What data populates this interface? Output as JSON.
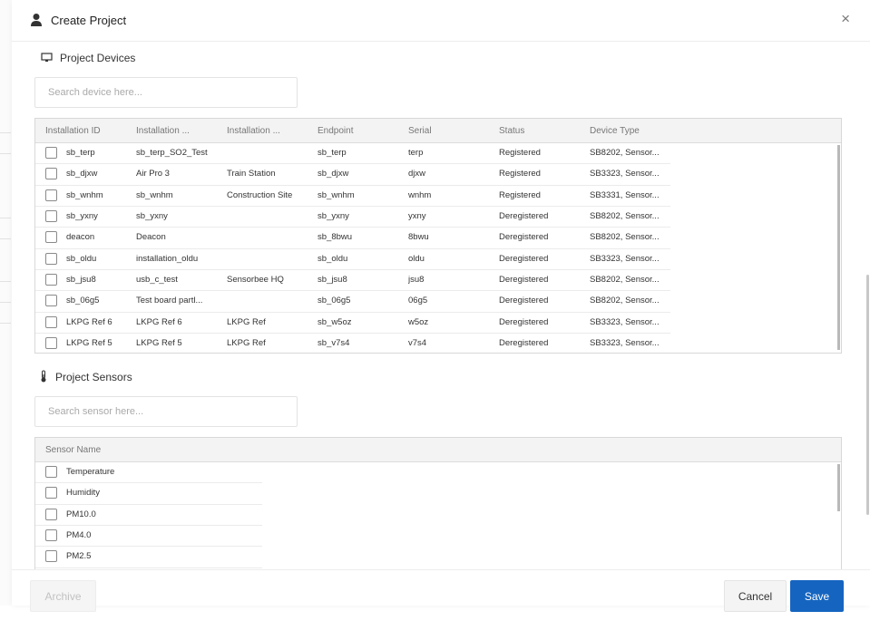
{
  "modal": {
    "title": "Create Project",
    "close_label": "×"
  },
  "devices": {
    "section_title": "Project Devices",
    "search_placeholder": "Search device here...",
    "columns": [
      "Installation ID",
      "Installation ...",
      "Installation ...",
      "Endpoint",
      "Serial",
      "Status",
      "Device Type"
    ],
    "rows": [
      [
        "sb_terp",
        "sb_terp_SO2_Test",
        "",
        "sb_terp",
        "terp",
        "Registered",
        "SB8202, Sensor..."
      ],
      [
        "sb_djxw",
        "Air Pro 3",
        "Train Station",
        "sb_djxw",
        "djxw",
        "Registered",
        "SB3323, Sensor..."
      ],
      [
        "sb_wnhm",
        "sb_wnhm",
        "Construction Site",
        "sb_wnhm",
        "wnhm",
        "Registered",
        "SB3331, Sensor..."
      ],
      [
        "sb_yxny",
        "sb_yxny",
        "",
        "sb_yxny",
        "yxny",
        "Deregistered",
        "SB8202, Sensor..."
      ],
      [
        "deacon",
        "Deacon",
        "",
        "sb_8bwu",
        "8bwu",
        "Deregistered",
        "SB8202, Sensor..."
      ],
      [
        "sb_oldu",
        "installation_oldu",
        "",
        "sb_oldu",
        "oldu",
        "Deregistered",
        "SB3323, Sensor..."
      ],
      [
        "sb_jsu8",
        "usb_c_test",
        "Sensorbee HQ",
        "sb_jsu8",
        "jsu8",
        "Deregistered",
        "SB8202, Sensor..."
      ],
      [
        "sb_06g5",
        "Test board partl...",
        "",
        "sb_06g5",
        "06g5",
        "Deregistered",
        "SB8202, Sensor..."
      ],
      [
        "LKPG Ref 6",
        "LKPG Ref 6",
        "LKPG Ref",
        "sb_w5oz",
        "w5oz",
        "Deregistered",
        "SB3323, Sensor..."
      ],
      [
        "LKPG Ref 5",
        "LKPG Ref 5",
        "LKPG Ref",
        "sb_v7s4",
        "v7s4",
        "Deregistered",
        "SB3323, Sensor..."
      ]
    ]
  },
  "sensors": {
    "section_title": "Project Sensors",
    "search_placeholder": "Search sensor here...",
    "column": "Sensor Name",
    "rows": [
      "Temperature",
      "Humidity",
      "PM10.0",
      "PM4.0",
      "PM2.5"
    ]
  },
  "footer": {
    "archive_label": "Archive",
    "cancel_label": "Cancel",
    "save_label": "Save"
  },
  "colors": {
    "primary": "#1565c0"
  }
}
